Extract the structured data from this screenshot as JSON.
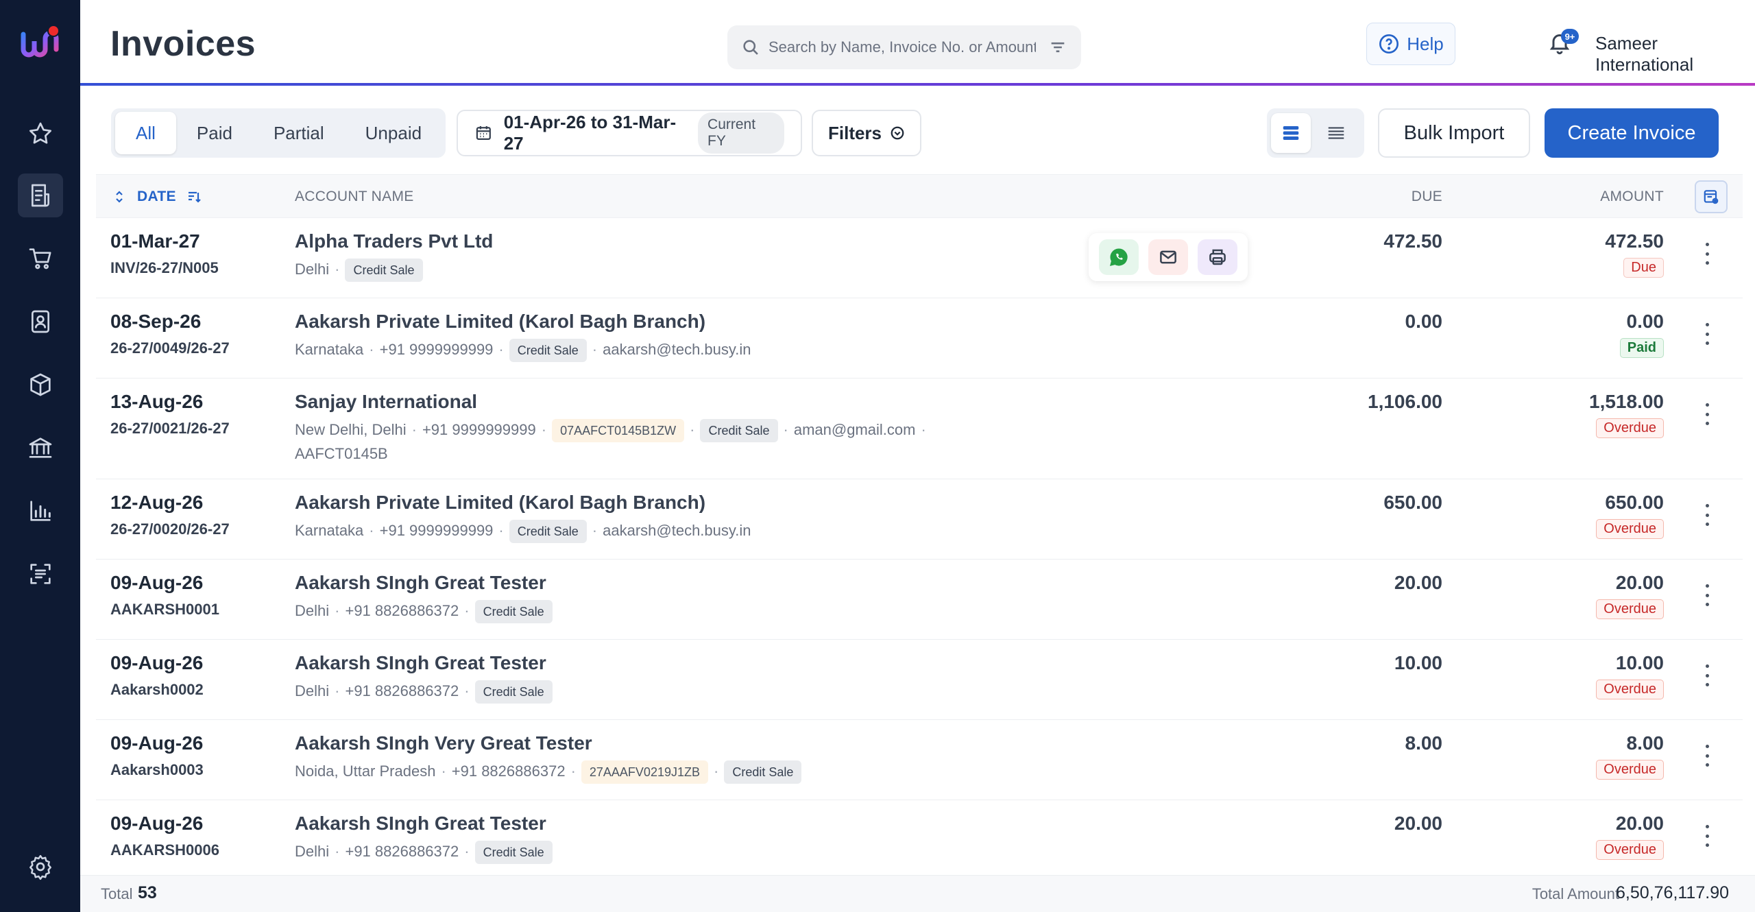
{
  "header": {
    "title": "Invoices",
    "search_placeholder": "Search by Name, Invoice No. or Amount",
    "help_label": "Help",
    "notification_badge": "9+",
    "company_name": "Sameer International"
  },
  "toolbar": {
    "tabs": [
      "All",
      "Paid",
      "Partial",
      "Unpaid"
    ],
    "active_tab": "All",
    "date_range": "01-Apr-26 to 31-Mar-27",
    "fy_label": "Current FY",
    "filters_label": "Filters",
    "bulk_import_label": "Bulk Import",
    "create_invoice_label": "Create Invoice"
  },
  "table": {
    "headers": {
      "date": "DATE",
      "account": "ACCOUNT NAME",
      "due": "DUE",
      "amount": "AMOUNT"
    },
    "rows": [
      {
        "date": "01-Mar-27",
        "invoice_no": "INV/26-27/N005",
        "account": "Alpha Traders Pvt Ltd",
        "location": "Delhi",
        "phone": "",
        "gstin": "",
        "tag": "Credit Sale",
        "email": "",
        "extra": "",
        "due": "472.50",
        "amount": "472.50",
        "status": "Due"
      },
      {
        "date": "08-Sep-26",
        "invoice_no": "26-27/0049/26-27",
        "account": "Aakarsh Private Limited (Karol Bagh Branch)",
        "location": "Karnataka",
        "phone": "+91 9999999999",
        "gstin": "",
        "tag": "Credit Sale",
        "email": "aakarsh@tech.busy.in",
        "extra": "",
        "due": "0.00",
        "amount": "0.00",
        "status": "Paid"
      },
      {
        "date": "13-Aug-26",
        "invoice_no": "26-27/0021/26-27",
        "account": "Sanjay International",
        "location": "New Delhi, Delhi",
        "phone": "+91 9999999999",
        "gstin": "07AAFCT0145B1ZW",
        "tag": "Credit Sale",
        "email": "aman@gmail.com",
        "extra": "AAFCT0145B",
        "due": "1,106.00",
        "amount": "1,518.00",
        "status": "Overdue"
      },
      {
        "date": "12-Aug-26",
        "invoice_no": "26-27/0020/26-27",
        "account": "Aakarsh Private Limited (Karol Bagh Branch)",
        "location": "Karnataka",
        "phone": "+91 9999999999",
        "gstin": "",
        "tag": "Credit Sale",
        "email": "aakarsh@tech.busy.in",
        "extra": "",
        "due": "650.00",
        "amount": "650.00",
        "status": "Overdue"
      },
      {
        "date": "09-Aug-26",
        "invoice_no": "AAKARSH0001",
        "account": "Aakarsh SIngh Great Tester",
        "location": "Delhi",
        "phone": "+91 8826886372",
        "gstin": "",
        "tag": "Credit Sale",
        "email": "",
        "extra": "",
        "due": "20.00",
        "amount": "20.00",
        "status": "Overdue"
      },
      {
        "date": "09-Aug-26",
        "invoice_no": "Aakarsh0002",
        "account": "Aakarsh SIngh Great Tester",
        "location": "Delhi",
        "phone": "+91 8826886372",
        "gstin": "",
        "tag": "Credit Sale",
        "email": "",
        "extra": "",
        "due": "10.00",
        "amount": "10.00",
        "status": "Overdue"
      },
      {
        "date": "09-Aug-26",
        "invoice_no": "Aakarsh0003",
        "account": "Aakarsh SIngh Very Great Tester",
        "location": "Noida, Uttar Pradesh",
        "phone": "+91 8826886372",
        "gstin": "27AAAFV0219J1ZB",
        "tag": "Credit Sale",
        "email": "",
        "extra": "",
        "due": "8.00",
        "amount": "8.00",
        "status": "Overdue"
      },
      {
        "date": "09-Aug-26",
        "invoice_no": "AAKARSH0006",
        "account": "Aakarsh SIngh Great Tester",
        "location": "Delhi",
        "phone": "+91 8826886372",
        "gstin": "",
        "tag": "Credit Sale",
        "email": "",
        "extra": "",
        "due": "20.00",
        "amount": "20.00",
        "status": "Overdue"
      }
    ]
  },
  "footer": {
    "total_label": "Total",
    "total_count": "53",
    "total_amount_label": "Total Amount",
    "total_amount": "6,50,76,117.90"
  },
  "sidebar": {
    "items": [
      "star-icon",
      "invoice-icon",
      "cart-icon",
      "contacts-icon",
      "box-icon",
      "bank-icon",
      "reports-icon",
      "scan-icon"
    ],
    "active_index": 1
  },
  "colors": {
    "accent": "#2563c9",
    "sidebar": "#0e1a33",
    "overdue": "#c62828",
    "paid": "#1b7a3a"
  }
}
